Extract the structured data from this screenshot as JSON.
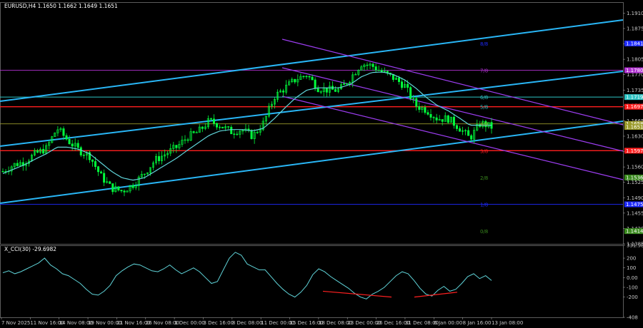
{
  "header": {
    "main_title": "EURUSD,H4  1.1650 1.1662 1.1649 1.1651",
    "indicator_title": "X_CCI(30) -29.6982"
  },
  "colors": {
    "background": "#000000",
    "candle": "#00ff3c",
    "ma": "#5fd3d8",
    "channel": "#29b6f6",
    "purple_channel": "#9c3df0",
    "murrey_red": "#ff1e1e",
    "murrey_blue": "#1e2aff",
    "murrey_teal": "#2ec4c4",
    "murrey_purple": "#b030d0",
    "murrey_green": "#3a8a1e",
    "murrey_olive": "#9a9a2a",
    "cci": "#5fd3d8",
    "divergence": "#ff2020"
  },
  "chart_data": [
    {
      "type": "candlestick",
      "symbol": "EURUSD",
      "timeframe": "H4",
      "ohlc": {
        "open": 1.165,
        "high": 1.1662,
        "low": 1.1649,
        "close": 1.1651
      },
      "ylim": [
        1.1385,
        1.1935
      ],
      "y_ticks": [
        1.191,
        1.1875,
        1.184,
        1.1805,
        1.177,
        1.1735,
        1.17,
        1.1665,
        1.163,
        1.1595,
        1.156,
        1.1525,
        1.149,
        1.1455,
        1.142,
        1.1385
      ],
      "right_labels": [
        {
          "value": 1.1841,
          "text": "1.1841",
          "color": "#1e2aff"
        },
        {
          "value": 1.178,
          "text": "1.1780",
          "color": "#b030d0"
        },
        {
          "value": 1.1719,
          "text": "1.1719",
          "color": "#2ec4c4"
        },
        {
          "value": 1.1697,
          "text": "1.1697",
          "color": "#ff1e1e"
        },
        {
          "value": 1.1658,
          "text": "1.1658",
          "color": "#9a9a2a"
        },
        {
          "value": 1.1651,
          "text": "1.1651",
          "color": "#9a9a2a"
        },
        {
          "value": 1.1597,
          "text": "1.1597",
          "color": "#ff1e1e"
        },
        {
          "value": 1.1536,
          "text": "1.1536",
          "color": "#3a8a1e"
        },
        {
          "value": 1.1475,
          "text": "1.1475",
          "color": "#1e2aff"
        },
        {
          "value": 1.1414,
          "text": "1.1414",
          "color": "#3a8a1e"
        }
      ],
      "murrey_levels": [
        {
          "value": 1.1841,
          "name": "8/8",
          "color": "#1e2aff",
          "line": false
        },
        {
          "value": 1.178,
          "name": "7/8",
          "color": "#b030d0",
          "line": true
        },
        {
          "value": 1.1719,
          "name": "6/8",
          "color": "#2ec4c4",
          "line": true
        },
        {
          "value": 1.1697,
          "name": "",
          "color": "#ff1e1e",
          "line": true
        },
        {
          "value": 1.1658,
          "name": "",
          "color": "#9a9a2a",
          "line": true
        },
        {
          "value": 1.1597,
          "name": "",
          "color": "#ff1e1e",
          "line": true
        },
        {
          "value": 1.1536,
          "name": "2/8",
          "color": "#3a8a1e",
          "line": false
        },
        {
          "value": 1.1475,
          "name": "1/8",
          "color": "#1e2aff",
          "line": true
        },
        {
          "value": 1.1414,
          "name": "0/8",
          "color": "#3a8a1e",
          "line": false
        }
      ],
      "murrey_labels": [
        {
          "text": "8/8",
          "value": 1.1841,
          "color": "#1e2aff"
        },
        {
          "text": "7/8",
          "value": 1.178,
          "color": "#b030d0"
        },
        {
          "text": "6/8",
          "value": 1.1719,
          "color": "#2ec4c4"
        },
        {
          "text": "5/8",
          "value": 1.1697,
          "color": "#2ec4c4"
        },
        {
          "text": "4/8",
          "value": 1.1658,
          "color": "#9a9a2a"
        },
        {
          "text": "3/8",
          "value": 1.1597,
          "color": "#ff1e1e"
        },
        {
          "text": "2/8",
          "value": 1.1536,
          "color": "#3a8a1e"
        },
        {
          "text": "1/8",
          "value": 1.1475,
          "color": "#1e2aff"
        },
        {
          "text": "0/8",
          "value": 1.1414,
          "color": "#3a8a1e"
        }
      ],
      "x_labels": [
        "7 Nov 2025",
        "11 Nov 16:00",
        "14 Nov 08:00",
        "19 Nov 00:00",
        "21 Nov 16:00",
        "26 Nov 08:00",
        "1 Dec 00:00",
        "3 Dec 16:00",
        "8 Dec 08:00",
        "11 Dec 00:00",
        "15 Dec 16:00",
        "18 Dec 08:00",
        "23 Dec 00:00",
        "26 Dec 16:00",
        "31 Dec 08:00",
        "6 Jan 00:00",
        "8 Jan 16:00",
        "13 Jan 08:00"
      ],
      "close_path": [
        1.155,
        1.1565,
        1.1572,
        1.159,
        1.1602,
        1.1648,
        1.162,
        1.1598,
        1.1585,
        1.154,
        1.1512,
        1.1505,
        1.152,
        1.1545,
        1.1575,
        1.159,
        1.1605,
        1.1628,
        1.164,
        1.1665,
        1.1655,
        1.164,
        1.1645,
        1.163,
        1.166,
        1.172,
        1.174,
        1.176,
        1.177,
        1.174,
        1.1735,
        1.1735,
        1.1762,
        1.1795,
        1.179,
        1.1775,
        1.1762,
        1.1745,
        1.17,
        1.169,
        1.167,
        1.167,
        1.165,
        1.1625,
        1.166,
        1.1651
      ],
      "ma_path": [
        1.1545,
        1.1555,
        1.1565,
        1.1578,
        1.159,
        1.1605,
        1.1605,
        1.16,
        1.159,
        1.157,
        1.155,
        1.1535,
        1.153,
        1.1535,
        1.155,
        1.1565,
        1.158,
        1.1598,
        1.1615,
        1.1632,
        1.1642,
        1.1645,
        1.1645,
        1.1642,
        1.1648,
        1.167,
        1.1695,
        1.1718,
        1.1735,
        1.174,
        1.174,
        1.174,
        1.1748,
        1.1765,
        1.1775,
        1.1776,
        1.177,
        1.1758,
        1.174,
        1.1718,
        1.17,
        1.1688,
        1.1672,
        1.1655,
        1.1655,
        1.1655
      ]
    },
    {
      "type": "line",
      "name": "X_CCI(30)",
      "value": -29.6982,
      "ylim": [
        -408,
        331.986
      ],
      "y_ticks": [
        331.986,
        200,
        100,
        0.0,
        -100,
        -200,
        -408
      ],
      "y_tick_labels": [
        "331.986",
        "200",
        "100",
        "0.00",
        "-100",
        "-200",
        "-408"
      ],
      "values": [
        50,
        70,
        40,
        60,
        90,
        120,
        150,
        200,
        130,
        90,
        40,
        20,
        -20,
        -60,
        -120,
        -170,
        -180,
        -140,
        -80,
        20,
        70,
        110,
        140,
        130,
        100,
        70,
        60,
        90,
        130,
        80,
        40,
        70,
        100,
        60,
        0,
        -60,
        -40,
        80,
        200,
        260,
        230,
        140,
        110,
        80,
        80,
        10,
        -60,
        -120,
        -170,
        -200,
        -150,
        -80,
        30,
        90,
        60,
        10,
        -30,
        -70,
        -110,
        -160,
        -200,
        -220,
        -170,
        -140,
        -100,
        -40,
        20,
        60,
        40,
        -30,
        -110,
        -170,
        -190,
        -130,
        -90,
        -140,
        -120,
        -60,
        10,
        40,
        -10,
        20,
        -30
      ]
    }
  ]
}
